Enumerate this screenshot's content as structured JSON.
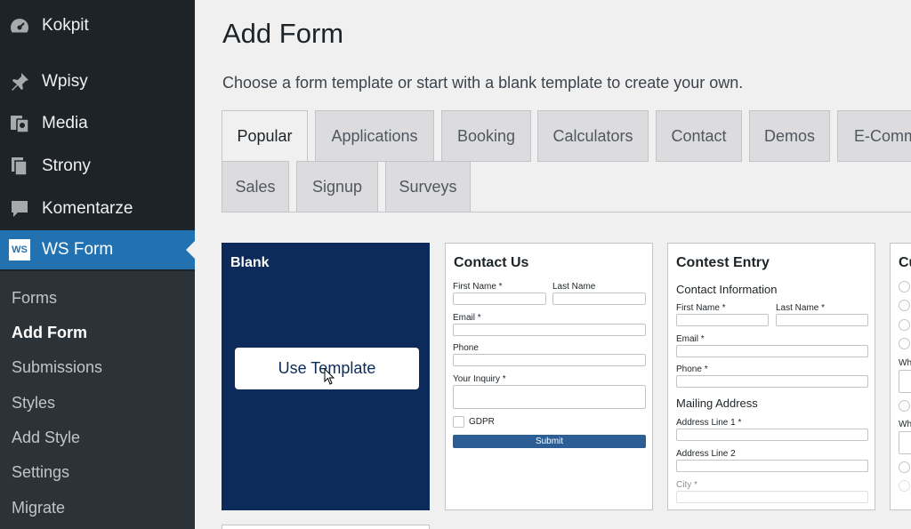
{
  "sidebar": {
    "items": [
      {
        "label": "Kokpit",
        "icon": "dashboard-icon"
      },
      {
        "label": "Wpisy",
        "icon": "pin-icon"
      },
      {
        "label": "Media",
        "icon": "media-icon"
      },
      {
        "label": "Strony",
        "icon": "pages-icon"
      },
      {
        "label": "Komentarze",
        "icon": "comments-icon"
      },
      {
        "label": "WS Form",
        "icon": "ws-form-icon",
        "logo_text": "WS"
      }
    ],
    "submenu": [
      "Forms",
      "Add Form",
      "Submissions",
      "Styles",
      "Add Style",
      "Settings",
      "Migrate"
    ],
    "current_submenu": "Add Form"
  },
  "page": {
    "title": "Add Form",
    "subtitle": "Choose a form template or start with a blank template to create your own."
  },
  "tabs": [
    "Popular",
    "Applications",
    "Booking",
    "Calculators",
    "Contact",
    "Demos",
    "E-Comm",
    "Sales",
    "Signup",
    "Surveys"
  ],
  "active_tab": "Popular",
  "cards": {
    "blank": {
      "title": "Blank",
      "button": "Use Template"
    },
    "contact_us": {
      "title": "Contact Us",
      "first_name": "First Name *",
      "last_name": "Last Name",
      "email": "Email *",
      "phone": "Phone",
      "inquiry": "Your Inquiry *",
      "gdpr": "GDPR",
      "submit": "Submit"
    },
    "contest_entry": {
      "title": "Contest Entry",
      "contact_info": "Contact Information",
      "first_name": "First Name *",
      "last_name": "Last Name *",
      "email": "Email *",
      "phone": "Phone *",
      "mailing": "Mailing Address",
      "address1": "Address Line 1 *",
      "address2": "Address Line 2",
      "city": "City *"
    },
    "partial": {
      "title": "Cu",
      "label1": "Wh",
      "label2": "Wh"
    }
  },
  "colors": {
    "sidebar": "#1d2327",
    "accent": "#2271b1",
    "blank_card": "#0c2a5a"
  }
}
